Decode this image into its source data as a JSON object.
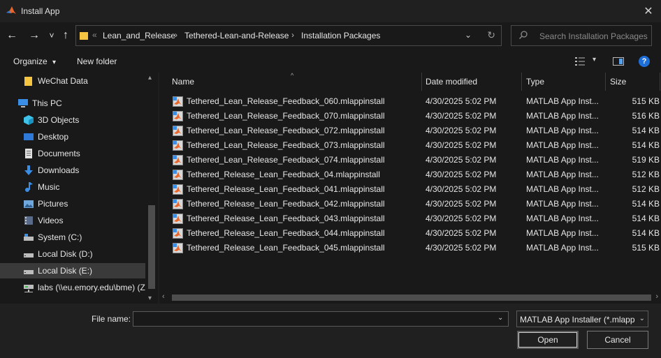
{
  "window": {
    "title": "Install App",
    "close_glyph": "✕"
  },
  "nav": {
    "back_glyph": "←",
    "forward_glyph": "→",
    "recent_glyph": "˅",
    "up_glyph": "↑",
    "breadcrumb_overflow": "«",
    "breadcrumbs": [
      "Lean_and_Release",
      "Tethered-Lean-and-Release",
      "Installation Packages"
    ],
    "breadcrumb_separator": "›",
    "address_dropdown_glyph": "⌄",
    "refresh_glyph": "↻",
    "search_placeholder": "Search Installation Packages"
  },
  "toolbar": {
    "organize_label": "Organize",
    "organize_caret": "▾",
    "new_folder_label": "New folder",
    "view_caret": "▾",
    "help_glyph": "?"
  },
  "sidebar": {
    "scroll_up": "▴",
    "scroll_down": "▾",
    "items": [
      {
        "label": "WeChat Data",
        "icon": "folder-icon"
      },
      {
        "label": "This PC",
        "icon": "computer-icon"
      },
      {
        "label": "3D Objects",
        "icon": "cube-icon"
      },
      {
        "label": "Desktop",
        "icon": "desktop-icon"
      },
      {
        "label": "Documents",
        "icon": "document-icon"
      },
      {
        "label": "Downloads",
        "icon": "download-icon"
      },
      {
        "label": "Music",
        "icon": "music-icon"
      },
      {
        "label": "Pictures",
        "icon": "picture-icon"
      },
      {
        "label": "Videos",
        "icon": "video-icon"
      },
      {
        "label": "System (C:)",
        "icon": "drive-icon"
      },
      {
        "label": "Local Disk (D:)",
        "icon": "drive-icon"
      },
      {
        "label": "Local Disk (E:)",
        "icon": "drive-icon"
      },
      {
        "label": "labs (\\\\eu.emory.edu\\bme) (Z",
        "icon": "network-drive-icon"
      }
    ]
  },
  "columns": {
    "name": "Name",
    "date": "Date modified",
    "type": "Type",
    "size": "Size"
  },
  "files": [
    {
      "name": "Tethered_Lean_Release_Feedback_060.mlappinstall",
      "date": "4/30/2025 5:02 PM",
      "type": "MATLAB App Inst...",
      "size": "515 KB"
    },
    {
      "name": "Tethered_Lean_Release_Feedback_070.mlappinstall",
      "date": "4/30/2025 5:02 PM",
      "type": "MATLAB App Inst...",
      "size": "516 KB"
    },
    {
      "name": "Tethered_Lean_Release_Feedback_072.mlappinstall",
      "date": "4/30/2025 5:02 PM",
      "type": "MATLAB App Inst...",
      "size": "514 KB"
    },
    {
      "name": "Tethered_Lean_Release_Feedback_073.mlappinstall",
      "date": "4/30/2025 5:02 PM",
      "type": "MATLAB App Inst...",
      "size": "514 KB"
    },
    {
      "name": "Tethered_Lean_Release_Feedback_074.mlappinstall",
      "date": "4/30/2025 5:02 PM",
      "type": "MATLAB App Inst...",
      "size": "519 KB"
    },
    {
      "name": "Tethered_Release_Lean_Feedback_04.mlappinstall",
      "date": "4/30/2025 5:02 PM",
      "type": "MATLAB App Inst...",
      "size": "512 KB"
    },
    {
      "name": "Tethered_Release_Lean_Feedback_041.mlappinstall",
      "date": "4/30/2025 5:02 PM",
      "type": "MATLAB App Inst...",
      "size": "512 KB"
    },
    {
      "name": "Tethered_Release_Lean_Feedback_042.mlappinstall",
      "date": "4/30/2025 5:02 PM",
      "type": "MATLAB App Inst...",
      "size": "514 KB"
    },
    {
      "name": "Tethered_Release_Lean_Feedback_043.mlappinstall",
      "date": "4/30/2025 5:02 PM",
      "type": "MATLAB App Inst...",
      "size": "514 KB"
    },
    {
      "name": "Tethered_Release_Lean_Feedback_044.mlappinstall",
      "date": "4/30/2025 5:02 PM",
      "type": "MATLAB App Inst...",
      "size": "514 KB"
    },
    {
      "name": "Tethered_Release_Lean_Feedback_045.mlappinstall",
      "date": "4/30/2025 5:02 PM",
      "type": "MATLAB App Inst...",
      "size": "515 KB"
    }
  ],
  "hscroll": {
    "left": "‹",
    "right": "›"
  },
  "footer": {
    "file_name_label": "File name:",
    "file_name_value": "",
    "file_name_dropdown": "⌄",
    "filter_value": "MATLAB App Installer (*.mlapp",
    "filter_dropdown": "⌄",
    "open_label": "Open",
    "cancel_label": "Cancel"
  },
  "colors": {
    "background": "#191919",
    "titlebar": "#202020",
    "selected": "#3a3a3a",
    "accent": "#1e6ed8",
    "folder": "#f5c542"
  }
}
